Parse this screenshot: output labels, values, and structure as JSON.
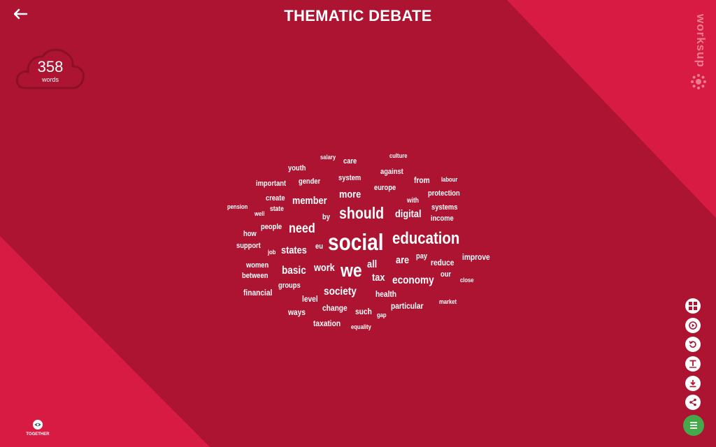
{
  "header": {
    "title": "THEMATIC DEBATE"
  },
  "counter": {
    "count": "358",
    "label": "words"
  },
  "brand": {
    "name": "worksup"
  },
  "footer": {
    "logo_label": "TOGETHER"
  },
  "colors": {
    "background_dark": "#AD1431",
    "background_light": "#D81B42",
    "text": "#FFFFFF",
    "menu_button": "#45A84A"
  },
  "side_toolbar": {
    "buttons": [
      {
        "icon": "grid-icon"
      },
      {
        "icon": "play-icon"
      },
      {
        "icon": "refresh-icon"
      },
      {
        "icon": "text-format-icon"
      },
      {
        "icon": "download-icon"
      },
      {
        "icon": "share-icon"
      }
    ],
    "menu": {
      "icon": "hamburger-menu-icon"
    }
  },
  "word_cloud": {
    "words": [
      {
        "text": "salary",
        "size": 9
      },
      {
        "text": "care",
        "size": 11
      },
      {
        "text": "culture",
        "size": 9
      },
      {
        "text": "youth",
        "size": 11
      },
      {
        "text": "against",
        "size": 11
      },
      {
        "text": "labour",
        "size": 9
      },
      {
        "text": "system",
        "size": 11
      },
      {
        "text": "from",
        "size": 12
      },
      {
        "text": "important",
        "size": 11
      },
      {
        "text": "gender",
        "size": 11
      },
      {
        "text": "europe",
        "size": 11
      },
      {
        "text": "more",
        "size": 15
      },
      {
        "text": "protection",
        "size": 11
      },
      {
        "text": "create",
        "size": 11
      },
      {
        "text": "member",
        "size": 15
      },
      {
        "text": "with",
        "size": 10
      },
      {
        "text": "pension",
        "size": 9
      },
      {
        "text": "state",
        "size": 10
      },
      {
        "text": "systems",
        "size": 11
      },
      {
        "text": "well",
        "size": 9
      },
      {
        "text": "should",
        "size": 23
      },
      {
        "text": "digital",
        "size": 15
      },
      {
        "text": "by",
        "size": 11
      },
      {
        "text": "income",
        "size": 11
      },
      {
        "text": "people",
        "size": 11
      },
      {
        "text": "need",
        "size": 19
      },
      {
        "text": "how",
        "size": 11
      },
      {
        "text": "education",
        "size": 24
      },
      {
        "text": "social",
        "size": 33
      },
      {
        "text": "support",
        "size": 11
      },
      {
        "text": "eu",
        "size": 11
      },
      {
        "text": "states",
        "size": 15
      },
      {
        "text": "job",
        "size": 9
      },
      {
        "text": "pay",
        "size": 11
      },
      {
        "text": "improve",
        "size": 12
      },
      {
        "text": "are",
        "size": 15
      },
      {
        "text": "reduce",
        "size": 12
      },
      {
        "text": "all",
        "size": 15
      },
      {
        "text": "women",
        "size": 11
      },
      {
        "text": "work",
        "size": 15
      },
      {
        "text": "we",
        "size": 27
      },
      {
        "text": "basic",
        "size": 16
      },
      {
        "text": "our",
        "size": 11
      },
      {
        "text": "between",
        "size": 11
      },
      {
        "text": "tax",
        "size": 15
      },
      {
        "text": "economy",
        "size": 16
      },
      {
        "text": "close",
        "size": 9
      },
      {
        "text": "groups",
        "size": 11
      },
      {
        "text": "society",
        "size": 16
      },
      {
        "text": "financial",
        "size": 12
      },
      {
        "text": "health",
        "size": 12
      },
      {
        "text": "level",
        "size": 12
      },
      {
        "text": "market",
        "size": 9
      },
      {
        "text": "change",
        "size": 12
      },
      {
        "text": "particular",
        "size": 12
      },
      {
        "text": "ways",
        "size": 12
      },
      {
        "text": "such",
        "size": 12
      },
      {
        "text": "gap",
        "size": 9
      },
      {
        "text": "taxation",
        "size": 12
      },
      {
        "text": "equality",
        "size": 9
      }
    ]
  }
}
